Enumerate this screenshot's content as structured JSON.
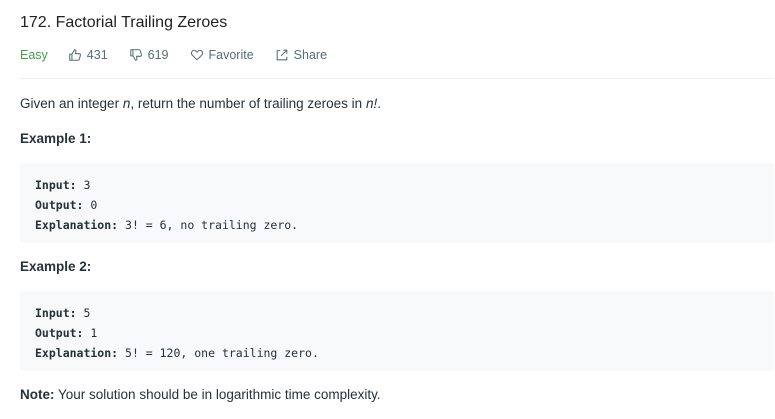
{
  "problem": {
    "title": "172. Factorial Trailing Zeroes",
    "difficulty": "Easy",
    "likes": "431",
    "dislikes": "619",
    "favorite_label": "Favorite",
    "share_label": "Share"
  },
  "description": {
    "part1": "Given an integer ",
    "var_n": "n",
    "part2": ", return the number of trailing zeroes in ",
    "var_nfact": "n!",
    "part3": "."
  },
  "examples": [
    {
      "heading": "Example 1:",
      "input_label": "Input:",
      "input_value": " 3",
      "output_label": "Output:",
      "output_value": " 0",
      "explanation_label": "Explanation:",
      "explanation_value": " 3! = 6, no trailing zero."
    },
    {
      "heading": "Example 2:",
      "input_label": "Input:",
      "input_value": " 5",
      "output_label": "Output:",
      "output_value": " 1",
      "explanation_label": "Explanation:",
      "explanation_value": " 5! = 120, one trailing zero."
    }
  ],
  "note": {
    "label": "Note:",
    "text": " Your solution should be in logarithmic time complexity."
  },
  "icons": {
    "like": "thumbs-up-icon",
    "dislike": "thumbs-down-icon",
    "favorite": "heart-icon",
    "share": "share-icon"
  },
  "colors": {
    "easy": "#43a047",
    "meta_text": "#546e7a",
    "code_background": "#f7f9fa"
  }
}
